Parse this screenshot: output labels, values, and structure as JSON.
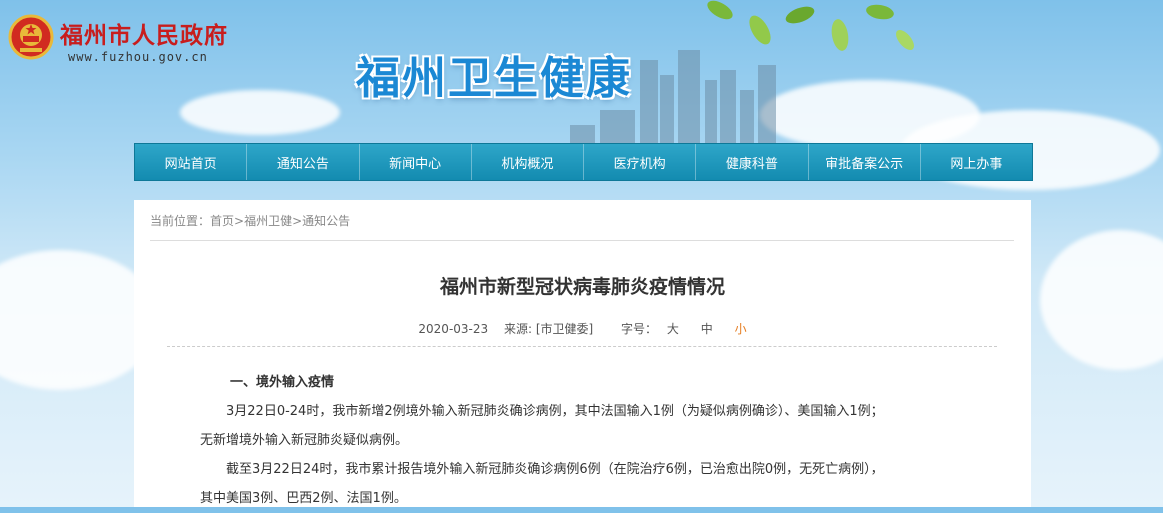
{
  "header": {
    "gov_name": "福州市人民政府",
    "gov_url": "www.fuzhou.gov.cn",
    "site_name": "福州卫生健康"
  },
  "nav": {
    "items": [
      "网站首页",
      "通知公告",
      "新闻中心",
      "机构概况",
      "医疗机构",
      "健康科普",
      "审批备案公示",
      "网上办事"
    ]
  },
  "breadcrumb": {
    "label": "当前位置：",
    "items": [
      "首页",
      "福州卫健",
      "通知公告"
    ],
    "separator": ">"
  },
  "article": {
    "title": "福州市新型冠状病毒肺炎疫情情况",
    "date": "2020-03-23",
    "source": "来源: [市卫健委]",
    "font_label": "字号：",
    "font_sizes": [
      "大",
      "中",
      "小"
    ],
    "paragraphs": [
      "一、境外输入疫情",
      "3月22日0-24时，我市新增2例境外输入新冠肺炎确诊病例，其中法国输入1例（为疑似病例确诊）、美国输入1例；",
      "无新增境外输入新冠肺炎疑似病例。",
      "截至3月22日24时，我市累计报告境外输入新冠肺炎确诊病例6例（在院治疗6例，已治愈出院0例，无死亡病例），",
      "其中美国3例、巴西2例、法国1例。"
    ]
  },
  "colors": {
    "nav_bg": "#138bb0",
    "gov_red": "#c81d1d",
    "site_blue": "#1b88d4",
    "active_size": "#e67e22"
  },
  "icons": [
    "national-emblem-icon",
    "leaves-decoration",
    "skyline-decoration"
  ]
}
